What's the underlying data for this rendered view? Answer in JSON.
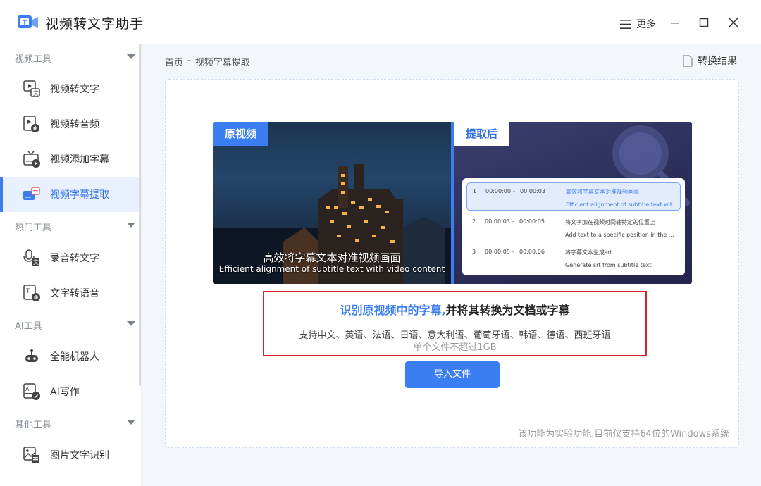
{
  "app": {
    "title": "视频转文字助手",
    "more_label": "更多"
  },
  "sidebar": {
    "categories": [
      {
        "label": "视频工具"
      },
      {
        "label": "热门工具"
      },
      {
        "label": "AI工具"
      },
      {
        "label": "其他工具"
      }
    ],
    "items": [
      {
        "label": "视频转文字",
        "icon": "video-to-text-icon"
      },
      {
        "label": "视频转音频",
        "icon": "video-to-audio-icon"
      },
      {
        "label": "视频添加字幕",
        "icon": "add-subtitle-icon"
      },
      {
        "label": "视频字幕提取",
        "icon": "subtitle-extract-icon",
        "active": true
      },
      {
        "label": "录音转文字",
        "icon": "recording-to-text-icon"
      },
      {
        "label": "文字转语音",
        "icon": "text-to-speech-icon"
      },
      {
        "label": "全能机器人",
        "icon": "robot-icon"
      },
      {
        "label": "AI写作",
        "icon": "ai-writing-icon"
      },
      {
        "label": "图片文字识别",
        "icon": "image-ocr-icon"
      }
    ]
  },
  "breadcrumb": {
    "home": "首页",
    "sep": "-",
    "current": "视频字幕提取"
  },
  "result_link": "转换结果",
  "preview": {
    "left_tag": "原视频",
    "right_tag": "提取后",
    "subtitle_zh": "高效将字幕文本对准视频画面",
    "subtitle_en": "Efficient alignment of subtitle text with video content",
    "rows": [
      {
        "n": "1",
        "start": "00:00:00",
        "dash": "-",
        "end": "00:00:03",
        "zh": "高效将字幕文本对准视频画面",
        "en": "Efficient alignment of subtitle text with ..."
      },
      {
        "n": "2",
        "start": "00:00:03",
        "dash": "-",
        "end": "00:00:05",
        "zh": "将文字加在视频时间轴特定的位置上",
        "en": "Add text to a specific position in the ..."
      },
      {
        "n": "3",
        "start": "00:00:05",
        "dash": "-",
        "end": "00:00:06",
        "zh": "将字幕文本生成srt",
        "en": "Generate srt from subtitle text"
      }
    ]
  },
  "info": {
    "title_highlight": "识别原视频中的字幕,",
    "title_rest": "并将其转换为文档或字幕",
    "languages": "支持中文、英语、法语、日语、意大利语、葡萄牙语、韩语、德语、西班牙语",
    "limit": "单个文件不超过1GB"
  },
  "import_button": "导入文件",
  "footnote": "该功能为实验功能,目前仅支持64位的Windows系统",
  "colors": {
    "accent": "#3a7ef2",
    "highlight_border": "#d0262d"
  }
}
